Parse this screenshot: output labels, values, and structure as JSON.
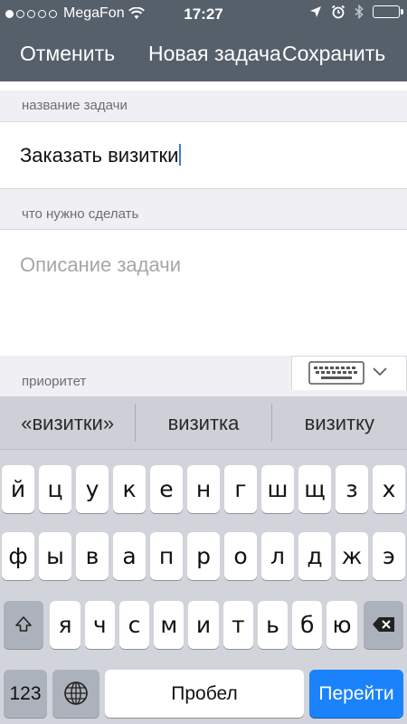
{
  "status_bar": {
    "carrier": "MegaFon",
    "time": "17:27",
    "signal_bars_filled": 1,
    "signal_bars_total": 5
  },
  "nav": {
    "cancel_label": "Отменить",
    "title": "Новая задача",
    "save_label": "Сохранить"
  },
  "form": {
    "name_label": "название задачи",
    "name_value": "Заказать визитки",
    "description_label": "что нужно сделать",
    "description_placeholder": "Описание задачи",
    "priority_label": "приоритет"
  },
  "keyboard": {
    "suggestions": [
      "«визитки»",
      "визитка",
      "визитку"
    ],
    "row1": [
      "й",
      "ц",
      "у",
      "к",
      "е",
      "н",
      "г",
      "ш",
      "щ",
      "з",
      "х"
    ],
    "row2": [
      "ф",
      "ы",
      "в",
      "а",
      "п",
      "р",
      "о",
      "л",
      "д",
      "ж",
      "э"
    ],
    "row3": [
      "я",
      "ч",
      "с",
      "м",
      "и",
      "т",
      "ь",
      "б",
      "ю"
    ],
    "numbers_label": "123",
    "space_label": "Пробел",
    "go_label": "Перейти"
  },
  "colors": {
    "header_bg": "#56606b",
    "go_button": "#1a82fb",
    "section_bg": "#efeff4"
  }
}
